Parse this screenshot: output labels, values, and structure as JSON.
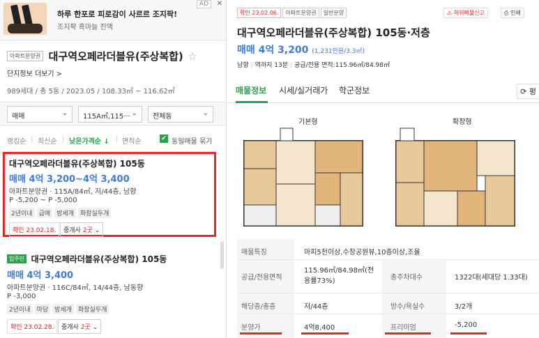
{
  "ad": {
    "title": "하루 한포로 피로감이 사르르 조지팍!",
    "subtitle": "조지팍 흑마늘 진액",
    "ad_tag": "AD",
    "close": "✕"
  },
  "complex": {
    "type_tag": "아파트분양권",
    "name": "대구역오페라더블유(주상복합)",
    "star": "☆",
    "more_link": "단지정보 더보기 >",
    "summary": "989세대 / 총 5동 / 2023.05 / 108.33㎡ ~ 116.62㎡"
  },
  "filters": {
    "trade": "매매",
    "area": "115A㎡,115···",
    "dong": "전체동"
  },
  "sort": {
    "items": [
      "랭킹순",
      "최신순",
      "낮은가격순 ↓",
      "면적순"
    ],
    "same_listing": "동일매물 묶기",
    "check": "✔"
  },
  "listings": [
    {
      "title": "대구역오페라더블유(주상복합) 105동",
      "price": "매매 4억 3,200~4억 3,400",
      "info": "아파트분양권 · 115A/84㎡, 저/44층, 남향",
      "range": "P -5,200 ~ P -5,000",
      "chips": [
        "2년이내",
        "급매",
        "방세개",
        "화장실두개"
      ],
      "confirmed": "확인 23.02.18.",
      "agent_prefix": "중개사",
      "agent_count": "2곳",
      "agent_chev": "⌄"
    },
    {
      "tag": "입주민",
      "title": "대구역오페라더블유(주상복합) 105동",
      "price": "매매 4억 3,400",
      "info": "아파트분양권 · 116C/84㎡, 14/44층, 남동향",
      "range": "P -3,000",
      "chips": [
        "2년이내",
        "마당",
        "방세개",
        "화장실두개"
      ],
      "confirmed": "확인 23.02.28.",
      "agent_prefix": "중개사",
      "agent_count": "2곳",
      "agent_chev": "⌄"
    }
  ],
  "detail": {
    "tags": [
      "확인 23.02.06.",
      "아파트분양권",
      "일반분양"
    ],
    "report": "허위매물신고",
    "print": "인쇄",
    "title": "대구역오페라더블유(주상복합) 105동·저층",
    "price": "매매 4억 3,200",
    "per_area": "(1,231만원/3.3㎡)",
    "meta": [
      "남향",
      "역까지 13분",
      "공급/전용 면적:115.96㎡/84.98㎡"
    ],
    "tabs": [
      "매물정보",
      "시세/실거래가",
      "학군정보"
    ],
    "tab_right": "⟳ 평",
    "plan_labels": [
      "기본형",
      "확장형"
    ],
    "rows": [
      {
        "label": "매물특징",
        "value": "마피5천이상,수창공원뷰,10층이상,조율"
      },
      {
        "label": "공급/전용면적",
        "value": "115.96㎡/84.98㎡(전용률73%)",
        "label2": "총주차대수",
        "value2": "1322대(세대당 1.33대)"
      },
      {
        "label": "해당층/총층",
        "value": "저/44층",
        "label2": "방수/욕실수",
        "value2": "3/2개"
      },
      {
        "label": "분양가",
        "value": "4억8,400",
        "label2": "프리미엄",
        "value2": "-5,200"
      }
    ]
  },
  "colors": {
    "accent_green": "#2aa24a",
    "price_blue": "#3d7ae0",
    "highlight_red": "#e8252a"
  }
}
